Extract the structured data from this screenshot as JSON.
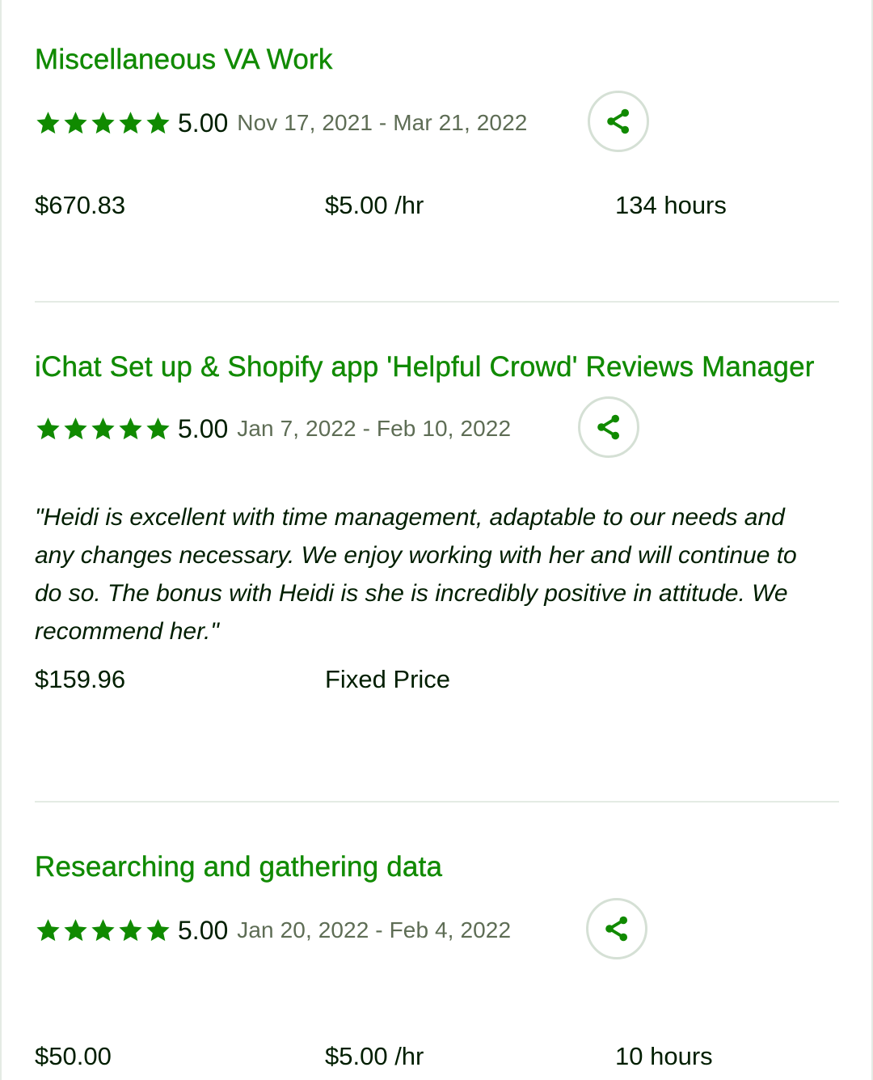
{
  "colors": {
    "accent": "#108a00",
    "text": "#001e00",
    "muted": "#5e6d55",
    "divider": "#e4ebe4"
  },
  "jobs": [
    {
      "title": "Miscellaneous VA Work",
      "rating": "5.00",
      "stars": 5,
      "dates": "Nov 17, 2021 - Mar 21, 2022",
      "amount": "$670.83",
      "rate": "$5.00 /hr",
      "hours": "134 hours",
      "share_icon": "share-icon"
    },
    {
      "title": "iChat Set up & Shopify app 'Helpful Crowd' Reviews Manager",
      "rating": "5.00",
      "stars": 5,
      "dates": "Jan 7, 2022 - Feb 10, 2022",
      "review": "\"Heidi is excellent with time management, adaptable to our needs and any changes necessary. We enjoy working with her and will continue to do so. The bonus with Heidi is she is incredibly positive in attitude. We recommend her.\"",
      "amount": "$159.96",
      "contract_type": "Fixed Price",
      "share_icon": "share-icon"
    },
    {
      "title": "Researching and gathering data",
      "rating": "5.00",
      "stars": 5,
      "dates": "Jan 20, 2022 - Feb 4, 2022",
      "amount": "$50.00",
      "rate": "$5.00 /hr",
      "hours": "10 hours",
      "share_icon": "share-icon"
    }
  ]
}
